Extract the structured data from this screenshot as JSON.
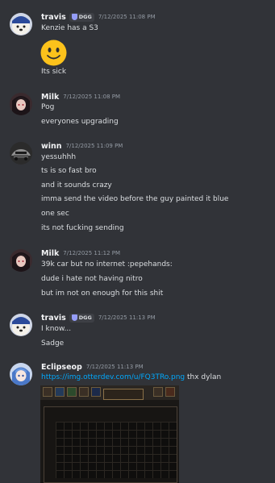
{
  "messages": [
    {
      "author": "travis",
      "tag": "DGG",
      "timestamp": "7/12/2025 11:08 PM",
      "lines": [
        "Kenzie has a S3",
        "Its sick"
      ],
      "emoji": "slightly-smiling-face"
    },
    {
      "author": "Milk",
      "timestamp": "7/12/2025 11:08 PM",
      "lines": [
        "Pog",
        "everyones upgrading"
      ]
    },
    {
      "author": "winn",
      "timestamp": "7/12/2025 11:09 PM",
      "lines": [
        "yessuhhh",
        "ts is so fast bro",
        "and it sounds crazy",
        "imma send the video before the guy painted it blue",
        "one sec",
        "its not fucking sending"
      ]
    },
    {
      "author": "Milk",
      "timestamp": "7/12/2025 11:12 PM",
      "lines": [
        "39k car but no internet :pepehands:",
        "dude i hate not having nitro",
        "but im not on enough for this shit"
      ]
    },
    {
      "author": "travis",
      "tag": "DGG",
      "timestamp": "7/12/2025 11:13 PM",
      "lines": [
        "I know...",
        "Sadge"
      ]
    },
    {
      "author": "Eclipseop",
      "timestamp": "7/12/2025 11:13 PM",
      "link": "https://img.otterdev.com/u/FQ3TRo.png",
      "link_suffix": " thx dylan"
    }
  ],
  "colors": {
    "background": "#313338",
    "link": "#00a8fc",
    "timestamp": "#949ba4",
    "author": "#f2f3f5"
  }
}
